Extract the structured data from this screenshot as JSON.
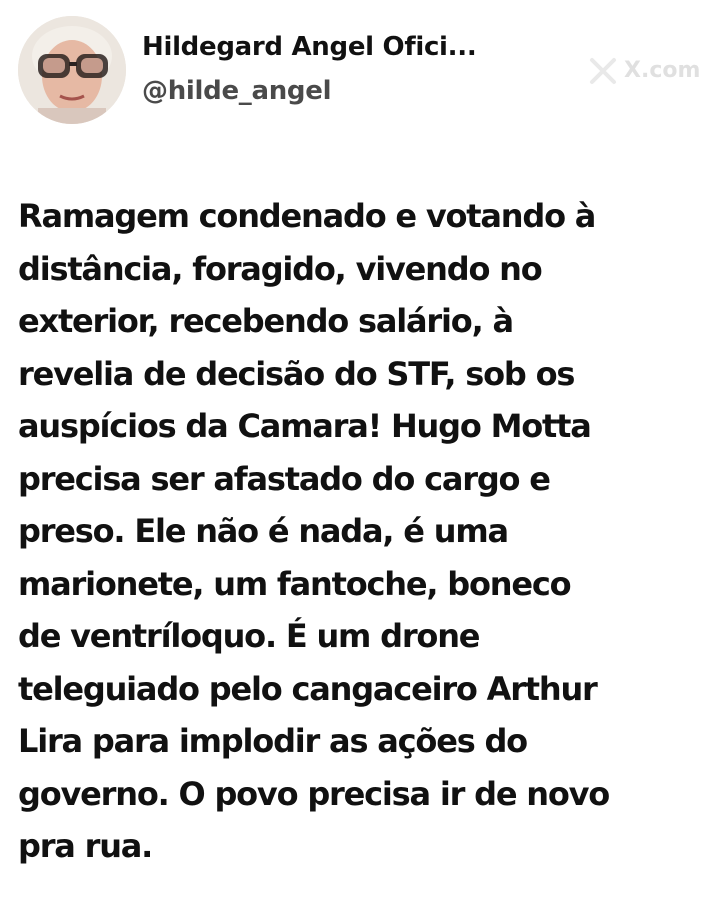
{
  "author": {
    "display_name": "Hildegard Angel Ofici...",
    "handle": "@hilde_angel"
  },
  "brand": {
    "icon": "x-logo-icon",
    "watermark_text": "X.com"
  },
  "post": {
    "lines": [
      "Ramagem condenado e votando à",
      "distância, foragido, vivendo no",
      "exterior, recebendo salário, à",
      "revelia de decisão do STF, sob os",
      "auspícios da Camara! Hugo Motta",
      "precisa ser afastado do cargo e",
      "preso. Ele não é nada, é uma",
      "marionete, um fantoche, boneco",
      "de ventríloquo. É um drone",
      "teleguiado pelo cangaceiro Arthur",
      "Lira para implodir as ações do",
      "governo. O povo precisa ir de novo",
      "pra rua."
    ]
  },
  "colors": {
    "background": "#ffffff",
    "text": "#111111",
    "handle": "#4a4a4a"
  }
}
